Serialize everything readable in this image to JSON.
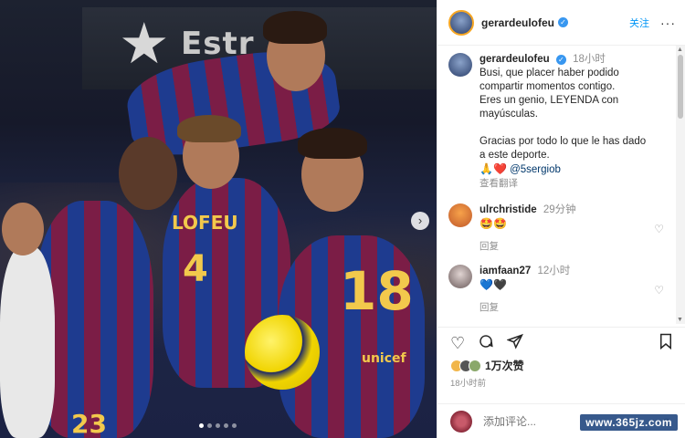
{
  "photo": {
    "banner_brand": "Estr",
    "shirt_name": "LOFEU",
    "number_left": "4",
    "number_center": "18",
    "number_bottom": "23",
    "sponsor": "unicef",
    "dots_total": 5,
    "dots_active": 1,
    "next_icon": "chevron-right-icon"
  },
  "header": {
    "username": "gerardeulofeu",
    "follow_label": "关注",
    "more_label": "···"
  },
  "caption": {
    "username": "gerardeulofeu",
    "time": "18小时",
    "line1": "Busi, que placer haber podido",
    "line2": "compartir momentos contigo.",
    "line3": "Eres un genio, LEYENDA con",
    "line4": "mayúsculas.",
    "line5": "Gracias por todo lo que le has dado",
    "line6": "a este deporte.",
    "line7_emoji": "🙏❤️",
    "mention": "@5sergiob",
    "translate_label": "查看翻译"
  },
  "comments": [
    {
      "username": "ulrchristide",
      "time": "29分钟",
      "text": "🤩🤩",
      "reply_label": "回复"
    },
    {
      "username": "iamfaan27",
      "time": "12小时",
      "text": "💙🖤",
      "reply_label": "回复"
    }
  ],
  "likes": {
    "count": "1万次赞"
  },
  "time_ago": "18小时前",
  "add_comment": {
    "placeholder": "添加评论..."
  },
  "watermark": "www.365jz.com",
  "colors": {
    "accent": "#0095f6",
    "verified": "#3897f0",
    "barca_blue": "#1e3b8f",
    "barca_red": "#7b1d46"
  }
}
